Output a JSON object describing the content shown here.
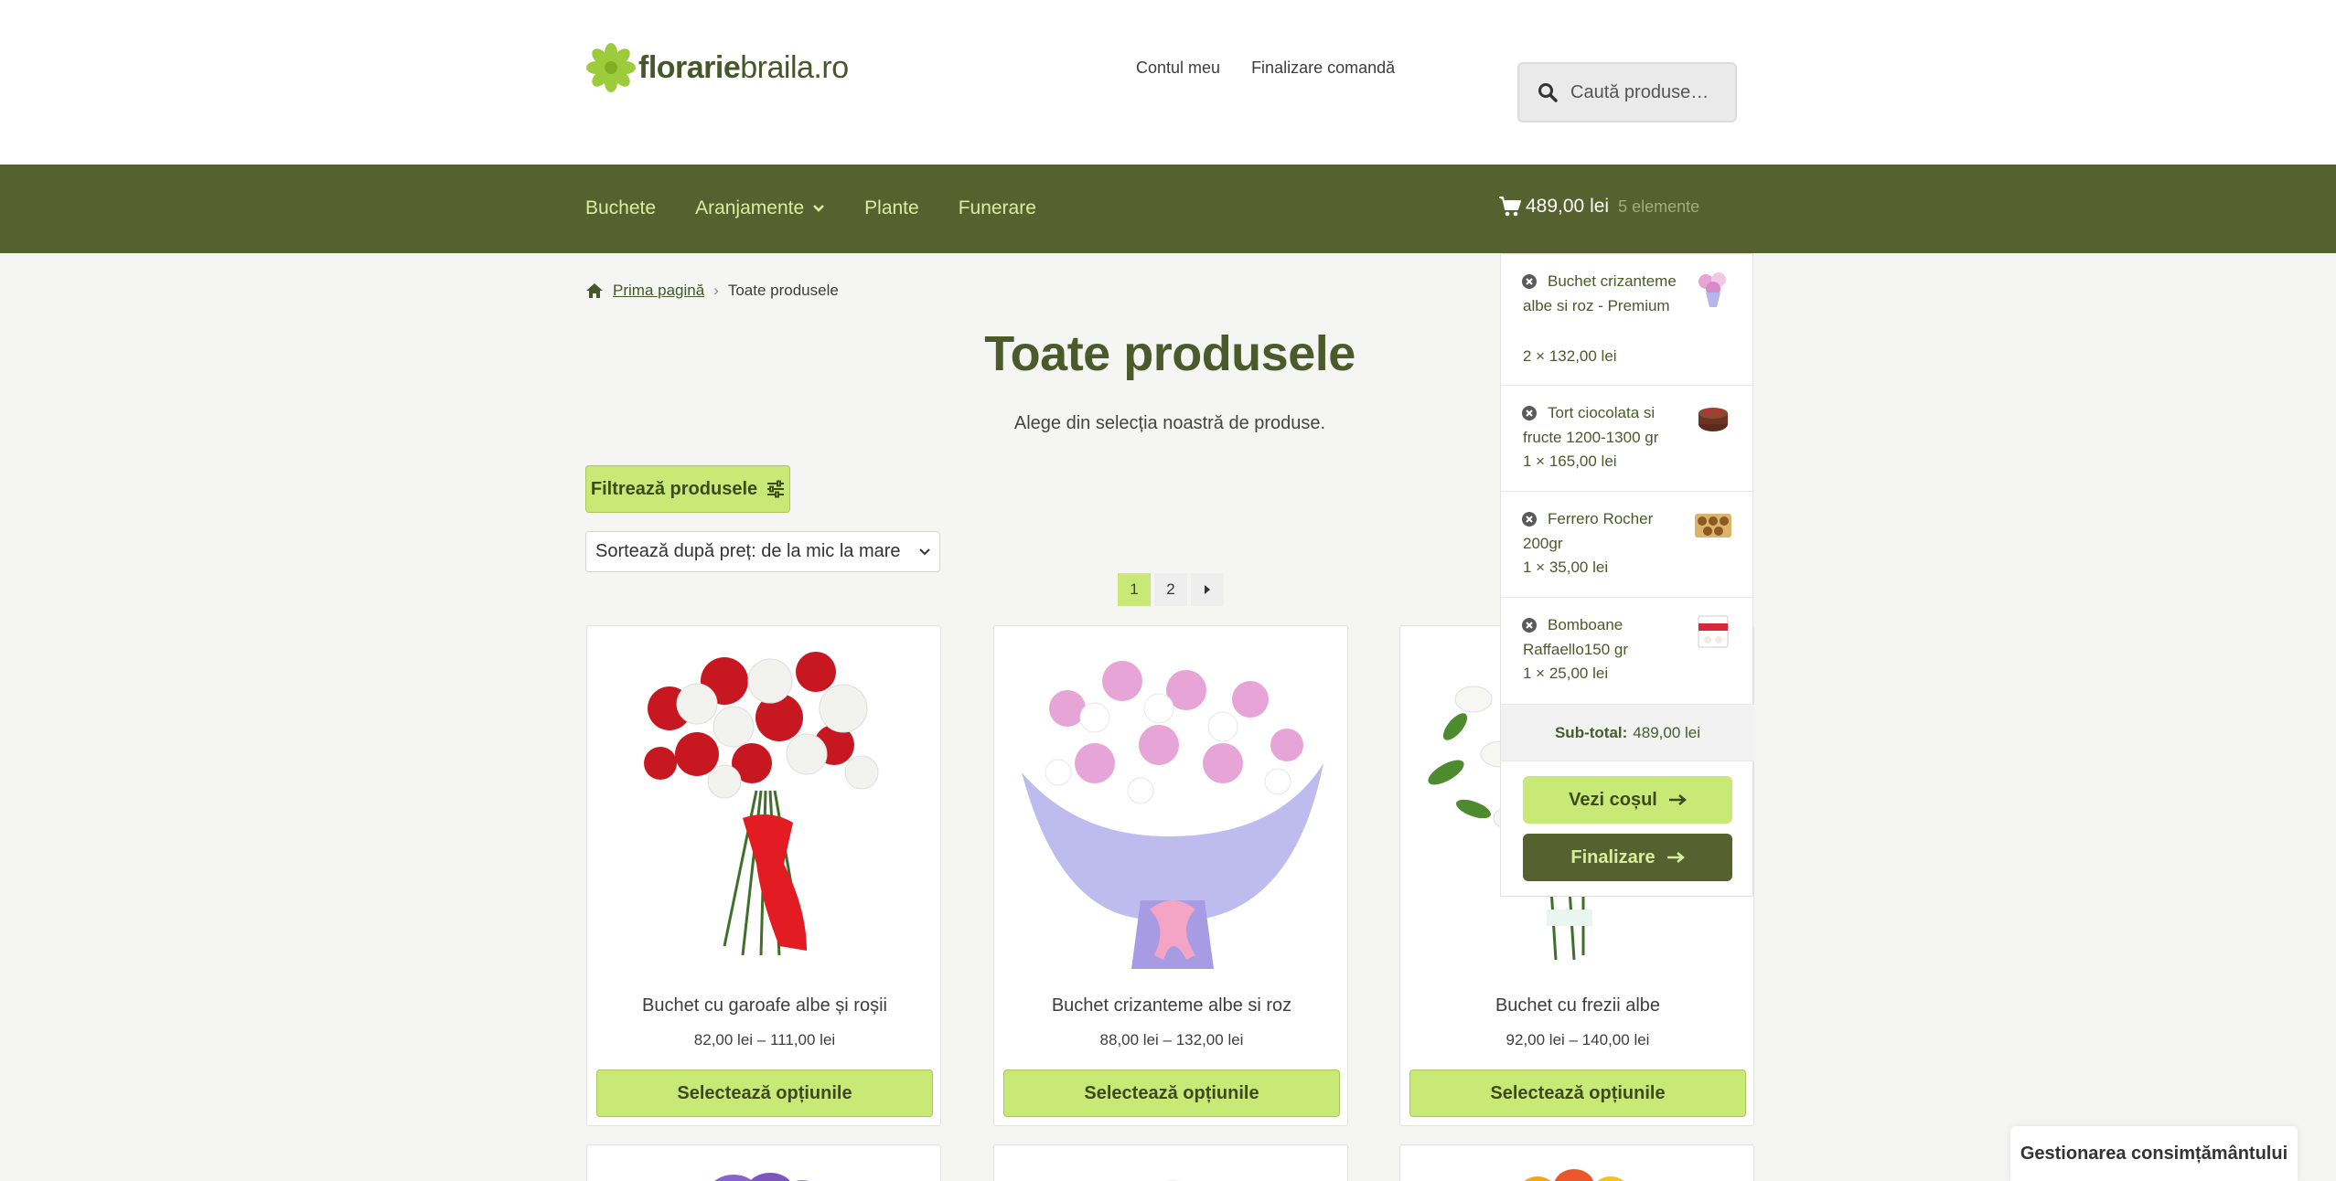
{
  "header": {
    "logo_bold": "florarie",
    "logo_rest": "braila.ro",
    "links": [
      {
        "label": "Contul meu"
      },
      {
        "label": "Finalizare comandă"
      }
    ],
    "search_placeholder": "Caută produse…"
  },
  "nav": {
    "items": [
      {
        "label": "Buchete"
      },
      {
        "label": "Aranjamente"
      },
      {
        "label": "Plante"
      },
      {
        "label": "Funerare"
      }
    ],
    "cart_total": "489,00 lei",
    "cart_count": "5 elemente"
  },
  "breadcrumb": {
    "home": "Prima pagină",
    "separator": "›",
    "current": "Toate produsele"
  },
  "page": {
    "title": "Toate produsele",
    "description": "Alege din selecția noastră de produse.",
    "filter_label": "Filtrează produsele",
    "sort_value": "Sortează după preț: de la mic la mare"
  },
  "pagination": {
    "pages": [
      "1",
      "2"
    ]
  },
  "products": [
    {
      "name": "Buchet cu garoafe albe și roșii",
      "price": "82,00 lei – 111,00 lei",
      "button": "Selectează opțiunile"
    },
    {
      "name": "Buchet crizanteme albe si roz",
      "price": "88,00 lei – 132,00 lei",
      "button": "Selectează opțiunile"
    },
    {
      "name": "Buchet cu frezii albe",
      "price": "92,00 lei – 140,00 lei",
      "button": "Selectează opțiunile"
    }
  ],
  "minicart": {
    "items": [
      {
        "title": "Buchet crizanteme albe si roz - Premium",
        "qty": "2 × 132,00 lei"
      },
      {
        "title": "Tort ciocolata si fructe 1200-1300 gr",
        "qty": "1 × 165,00 lei"
      },
      {
        "title": "Ferrero Rocher 200gr",
        "qty": "1 × 35,00 lei"
      },
      {
        "title": "Bomboane Raffaello150 gr",
        "qty": "1 × 25,00 lei"
      }
    ],
    "subtotal_label": "Sub-total:",
    "subtotal_value": "489,00 lei",
    "view_cart": "Vezi coșul",
    "checkout": "Finalizare"
  },
  "consent": "Gestionarea consimțământului",
  "colors": {
    "brand_dark": "#566130",
    "accent_lime": "#c9e977",
    "nav_text": "#d7ef9c"
  }
}
